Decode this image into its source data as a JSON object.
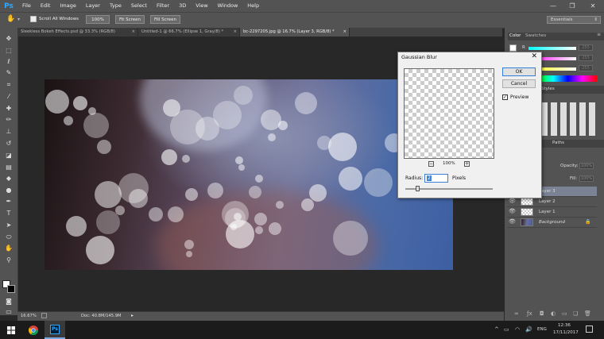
{
  "app": {
    "logo": "Ps",
    "menus": [
      "File",
      "Edit",
      "Image",
      "Layer",
      "Type",
      "Select",
      "Filter",
      "3D",
      "View",
      "Window",
      "Help"
    ],
    "window_controls": [
      "—",
      "❐",
      "✕"
    ]
  },
  "options_bar": {
    "scroll_all_windows": "Scroll All Windows",
    "zoom_value": "100%",
    "fit_screen": "Fit Screen",
    "fill_screen": "Fill Screen",
    "workspace": "Essentials"
  },
  "tabs": [
    {
      "label": "Sleekless Bokeh Effects.psd @ 33.3% (RGB/8)",
      "close": "×"
    },
    {
      "label": "Untitled-1 @ 66.7% (Ellipse 1, Gray/8) *",
      "close": "×"
    },
    {
      "label": "bc-2297205.jpg @ 16.7% (Layer 3, RGB/8) *",
      "close": "×"
    }
  ],
  "status_bar": {
    "zoom": "16.67%",
    "doc_info": "Doc: 40.8M/145.9M"
  },
  "panels": {
    "color_tab": "Color",
    "swatches_tab": "Swatches",
    "styles_tab": "Styles",
    "paths_tab": "Paths",
    "channel_labels": [
      "R",
      "G",
      "B"
    ],
    "channel_values": [
      "255",
      "255",
      "255"
    ],
    "opacity_label": "Opacity:",
    "opacity_value": "100%",
    "fill_label": "Fill:",
    "fill_value": "100%"
  },
  "layers": [
    {
      "name": "Layer 3",
      "selected": true
    },
    {
      "name": "Layer 2",
      "selected": false
    },
    {
      "name": "Layer 1",
      "selected": false
    },
    {
      "name": "Background",
      "selected": false
    }
  ],
  "dialog": {
    "title": "Gaussian Blur",
    "close": "✕",
    "ok_label": "OK",
    "cancel_label": "Cancel",
    "preview_label": "Preview",
    "preview_checked": true,
    "zoom_level": "100%",
    "zoom_out": "−",
    "zoom_in": "+",
    "radius_label": "Radius:",
    "radius_value": "2",
    "radius_unit": "Pixels"
  },
  "taskbar": {
    "start_icon": "windows-logo",
    "time": "12:36",
    "date": "17/11/2017",
    "lang": "ENG",
    "tray_chevron": "^",
    "ps_label": "Ps"
  },
  "colors": {
    "chrome": "#535353",
    "canvas_bg": "#282828",
    "ps_blue": "#31a8ff",
    "dialog_bg": "#f0f0f0",
    "selected_layer": "#7a8294"
  }
}
